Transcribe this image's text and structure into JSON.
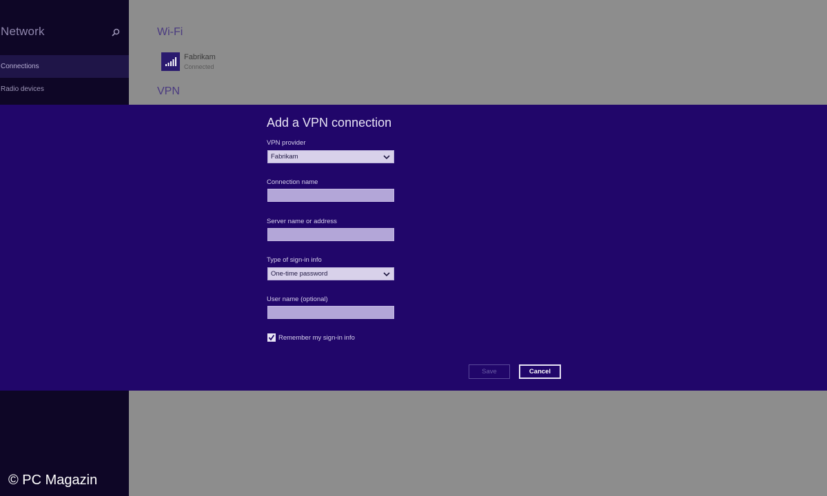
{
  "sidebar": {
    "title": "Network",
    "search_icon": "search-icon",
    "items": [
      {
        "label": "Connections",
        "selected": true
      },
      {
        "label": "Radio devices",
        "selected": false
      }
    ]
  },
  "main": {
    "wifi_heading": "Wi-Fi",
    "wifi_network": {
      "name": "Fabrikam",
      "status": "Connected",
      "icon": "wifi-signal-icon"
    },
    "vpn_heading": "VPN"
  },
  "dialog": {
    "title": "Add a VPN connection",
    "vpn_provider": {
      "label": "VPN provider",
      "value": "Fabrikam"
    },
    "connection_name": {
      "label": "Connection name",
      "value": ""
    },
    "server": {
      "label": "Server name or address",
      "value": ""
    },
    "signin_type": {
      "label": "Type of sign-in info",
      "value": "One-time password"
    },
    "username": {
      "label": "User name (optional)",
      "value": ""
    },
    "remember": {
      "label": "Remember my sign-in info",
      "checked": true
    },
    "save_label": "Save",
    "cancel_label": "Cancel"
  },
  "watermark": "© PC Magazin",
  "colors": {
    "dialog_background": "#21066a",
    "sidebar_background": "#0e0626",
    "content_dim": "#8d8d8d"
  }
}
